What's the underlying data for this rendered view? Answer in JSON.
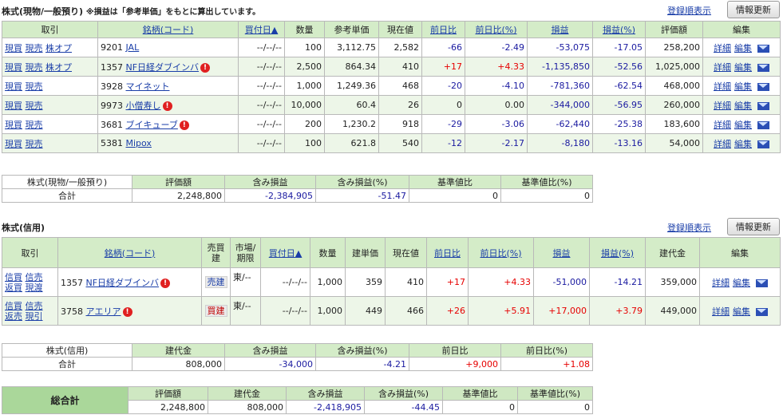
{
  "cash": {
    "title": "株式(現物/一般預り)",
    "note": "※損益は「参考単価」をもとに算出しています。",
    "order_link": "登録順表示",
    "refresh_button": "情報更新",
    "headers": [
      "取引",
      "銘柄(コード)",
      "買付日▲",
      "数量",
      "参考単価",
      "現在値",
      "前日比",
      "前日比(%)",
      "損益",
      "損益(%)",
      "評価額",
      "編集"
    ],
    "rows": [
      {
        "trade": [
          "現買",
          "現売",
          "株オプ"
        ],
        "code": "9201",
        "name": "JAL",
        "warn": false,
        "date": "--/--/--",
        "qty": "100",
        "ref_price": "3,112.75",
        "price": "2,582",
        "change": "-66",
        "change_pct": "-2.49",
        "pl": "-53,075",
        "pl_pct": "-17.05",
        "value": "258,200",
        "edit": [
          "詳細",
          "編集"
        ]
      },
      {
        "trade": [
          "現買",
          "現売",
          "株オプ"
        ],
        "code": "1357",
        "name": "NF日経ダブインバ",
        "warn": true,
        "date": "--/--/--",
        "qty": "2,500",
        "ref_price": "864.34",
        "price": "410",
        "change": "+17",
        "change_pct": "+4.33",
        "pl": "-1,135,850",
        "pl_pct": "-52.56",
        "value": "1,025,000",
        "edit": [
          "詳細",
          "編集"
        ]
      },
      {
        "trade": [
          "現買",
          "現売"
        ],
        "code": "3928",
        "name": "マイネット",
        "warn": false,
        "date": "--/--/--",
        "qty": "1,000",
        "ref_price": "1,249.36",
        "price": "468",
        "change": "-20",
        "change_pct": "-4.10",
        "pl": "-781,360",
        "pl_pct": "-62.54",
        "value": "468,000",
        "edit": [
          "詳細",
          "編集"
        ]
      },
      {
        "trade": [
          "現買",
          "現売"
        ],
        "code": "9973",
        "name": "小僧寿し",
        "warn": true,
        "date": "--/--/--",
        "qty": "10,000",
        "ref_price": "60.4",
        "price": "26",
        "change": "0",
        "change_pct": "0.00",
        "pl": "-344,000",
        "pl_pct": "-56.95",
        "value": "260,000",
        "edit": [
          "詳細",
          "編集"
        ]
      },
      {
        "trade": [
          "現買",
          "現売"
        ],
        "code": "3681",
        "name": "ブイキューブ",
        "warn": true,
        "date": "--/--/--",
        "qty": "200",
        "ref_price": "1,230.2",
        "price": "918",
        "change": "-29",
        "change_pct": "-3.06",
        "pl": "-62,440",
        "pl_pct": "-25.38",
        "value": "183,600",
        "edit": [
          "詳細",
          "編集"
        ]
      },
      {
        "trade": [
          "現買",
          "現売"
        ],
        "code": "5381",
        "name": "Mipox",
        "warn": false,
        "date": "--/--/--",
        "qty": "100",
        "ref_price": "621.8",
        "price": "540",
        "change": "-12",
        "change_pct": "-2.17",
        "pl": "-8,180",
        "pl_pct": "-13.16",
        "value": "54,000",
        "edit": [
          "詳細",
          "編集"
        ]
      }
    ],
    "summary": {
      "label1": "株式(現物/一般預り)",
      "label2": "合計",
      "headers": [
        "評価額",
        "含み損益",
        "含み損益(%)",
        "基準値比",
        "基準値比(%)"
      ],
      "values": [
        "2,248,800",
        "-2,384,905",
        "-51.47",
        "0",
        "0"
      ]
    }
  },
  "margin": {
    "title": "株式(信用)",
    "order_link": "登録順表示",
    "refresh_button": "情報更新",
    "headers": [
      "取引",
      "銘柄(コード)",
      "売買建",
      "市場/期限",
      "買付日▲",
      "数量",
      "建単価",
      "現在値",
      "前日比",
      "前日比(%)",
      "損益",
      "損益(%)",
      "建代金",
      "編集"
    ],
    "rows": [
      {
        "trade": [
          [
            "信買",
            "信売"
          ],
          [
            "返買",
            "現渡"
          ]
        ],
        "code": "1357",
        "name": "NF日経ダブインバ",
        "warn": true,
        "side": "売建",
        "market": "東/--",
        "date": "--/--/--",
        "qty": "1,000",
        "price_in": "359",
        "price": "410",
        "change": "+17",
        "change_pct": "+4.33",
        "pl": "-51,000",
        "pl_pct": "-14.21",
        "amount": "359,000",
        "edit": [
          "詳細",
          "編集"
        ]
      },
      {
        "trade": [
          [
            "信買",
            "信売"
          ],
          [
            "返売",
            "現引"
          ]
        ],
        "code": "3758",
        "name": "アエリア",
        "warn": true,
        "side": "買建",
        "market": "東/--",
        "date": "--/--/--",
        "qty": "1,000",
        "price_in": "449",
        "price": "466",
        "change": "+26",
        "change_pct": "+5.91",
        "pl": "+17,000",
        "pl_pct": "+3.79",
        "amount": "449,000",
        "edit": [
          "詳細",
          "編集"
        ]
      }
    ],
    "summary": {
      "label1": "株式(信用)",
      "label2": "合計",
      "headers": [
        "建代金",
        "含み損益",
        "含み損益(%)",
        "前日比",
        "前日比(%)"
      ],
      "values": [
        "808,000",
        "-34,000",
        "-4.21",
        "+9,000",
        "+1.08"
      ]
    }
  },
  "grand": {
    "label": "総合計",
    "headers": [
      "評価額",
      "建代金",
      "含み損益",
      "含み損益(%)",
      "基準値比",
      "基準値比(%)"
    ],
    "values": [
      "2,248,800",
      "808,000",
      "-2,418,905",
      "-44.45",
      "0",
      "0"
    ]
  }
}
